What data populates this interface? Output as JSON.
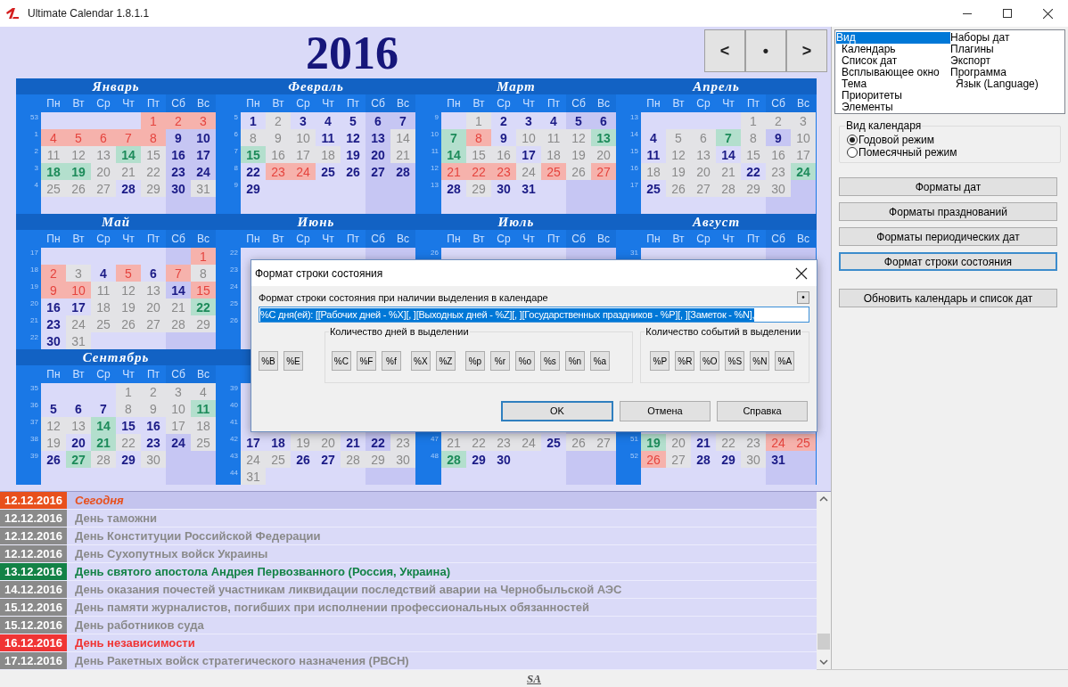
{
  "window": {
    "title": "Ultimate Calendar 1.8.1.1"
  },
  "header": {
    "year": "2016",
    "nav": [
      "<",
      "•",
      ">"
    ]
  },
  "months": [
    {
      "name": "Январь",
      "weekdays": [
        "Пн",
        "Вт",
        "Ср",
        "Чт",
        "Пт",
        "Сб",
        "Вс"
      ],
      "weeks": [
        {
          "week": "53",
          "days": [
            {
              "day": "1",
              "kind": "holiday"
            },
            {
              "day": "2",
              "kind": "holiday"
            },
            {
              "day": "3",
              "kind": "holiday"
            }
          ]
        },
        {
          "week": "1",
          "days": [
            {
              "day": "4",
              "kind": "holiday"
            },
            {
              "day": "5",
              "kind": "holiday"
            },
            {
              "day": "6",
              "kind": "holiday"
            },
            {
              "day": "7",
              "kind": "holiday"
            },
            {
              "day": "8",
              "kind": "holiday"
            },
            {
              "day": "9",
              "kind": "work"
            },
            {
              "day": "10",
              "kind": "work"
            }
          ]
        },
        {
          "week": "2",
          "days": [
            {
              "day": "11",
              "kind": "event"
            },
            {
              "day": "12",
              "kind": "event"
            },
            {
              "day": "13",
              "kind": "event"
            },
            {
              "day": "14",
              "kind": "green"
            },
            {
              "day": "15",
              "kind": "event"
            },
            {
              "day": "16",
              "kind": "work"
            },
            {
              "day": "17",
              "kind": "work"
            }
          ]
        },
        {
          "week": "3",
          "days": [
            {
              "day": "18",
              "kind": "green"
            },
            {
              "day": "19",
              "kind": "green"
            },
            {
              "day": "20",
              "kind": "event"
            },
            {
              "day": "21",
              "kind": "event"
            },
            {
              "day": "22",
              "kind": "event"
            },
            {
              "day": "23",
              "kind": "work"
            },
            {
              "day": "24",
              "kind": "work"
            }
          ]
        },
        {
          "week": "4",
          "days": [
            {
              "day": "25",
              "kind": "event"
            },
            {
              "day": "26",
              "kind": "event"
            },
            {
              "day": "27",
              "kind": "event"
            },
            {
              "day": "28",
              "kind": "work"
            },
            {
              "day": "29",
              "kind": "event"
            },
            {
              "day": "30",
              "kind": "work"
            },
            {
              "day": "31",
              "kind": "event"
            }
          ]
        }
      ]
    },
    {
      "name": "Февраль",
      "weekdays": [
        "Пн",
        "Вт",
        "Ср",
        "Чт",
        "Пт",
        "Сб",
        "Вс"
      ],
      "weeks": [
        {
          "week": "5",
          "days": [
            {
              "day": "1",
              "kind": "work"
            },
            {
              "day": "2",
              "kind": "event"
            },
            {
              "day": "3",
              "kind": "work"
            },
            {
              "day": "4",
              "kind": "work"
            },
            {
              "day": "5",
              "kind": "work"
            },
            {
              "day": "6",
              "kind": "work"
            },
            {
              "day": "7",
              "kind": "work"
            }
          ]
        },
        {
          "week": "6",
          "days": [
            {
              "day": "8",
              "kind": "event"
            },
            {
              "day": "9",
              "kind": "event"
            },
            {
              "day": "10",
              "kind": "event"
            },
            {
              "day": "11",
              "kind": "work"
            },
            {
              "day": "12",
              "kind": "work"
            },
            {
              "day": "13",
              "kind": "work"
            },
            {
              "day": "14",
              "kind": "event"
            }
          ]
        },
        {
          "week": "7",
          "days": [
            {
              "day": "15",
              "kind": "green"
            },
            {
              "day": "16",
              "kind": "event"
            },
            {
              "day": "17",
              "kind": "event"
            },
            {
              "day": "18",
              "kind": "event"
            },
            {
              "day": "19",
              "kind": "work"
            },
            {
              "day": "20",
              "kind": "work"
            },
            {
              "day": "21",
              "kind": "event"
            }
          ]
        },
        {
          "week": "8",
          "days": [
            {
              "day": "22",
              "kind": "work"
            },
            {
              "day": "23",
              "kind": "holiday"
            },
            {
              "day": "24",
              "kind": "holiday"
            },
            {
              "day": "25",
              "kind": "work"
            },
            {
              "day": "26",
              "kind": "work"
            },
            {
              "day": "27",
              "kind": "work"
            },
            {
              "day": "28",
              "kind": "work"
            }
          ]
        },
        {
          "week": "9",
          "days": [
            {
              "day": "29",
              "kind": "work"
            }
          ]
        }
      ]
    },
    {
      "name": "Март",
      "weekdays": [
        "Пн",
        "Вт",
        "Ср",
        "Чт",
        "Пт",
        "Сб",
        "Вс"
      ],
      "weeks": [
        {
          "week": "9",
          "days": [
            {
              "day": "1",
              "kind": "event"
            },
            {
              "day": "2",
              "kind": "work"
            },
            {
              "day": "3",
              "kind": "work"
            },
            {
              "day": "4",
              "kind": "work"
            },
            {
              "day": "5",
              "kind": "work"
            },
            {
              "day": "6",
              "kind": "work"
            }
          ]
        },
        {
          "week": "10",
          "days": [
            {
              "day": "7",
              "kind": "green"
            },
            {
              "day": "8",
              "kind": "holiday"
            },
            {
              "day": "9",
              "kind": "work"
            },
            {
              "day": "10",
              "kind": "event"
            },
            {
              "day": "11",
              "kind": "event"
            },
            {
              "day": "12",
              "kind": "event"
            },
            {
              "day": "13",
              "kind": "green"
            }
          ]
        },
        {
          "week": "11",
          "days": [
            {
              "day": "14",
              "kind": "green"
            },
            {
              "day": "15",
              "kind": "event"
            },
            {
              "day": "16",
              "kind": "event"
            },
            {
              "day": "17",
              "kind": "work"
            },
            {
              "day": "18",
              "kind": "event"
            },
            {
              "day": "19",
              "kind": "event"
            },
            {
              "day": "20",
              "kind": "event"
            }
          ]
        },
        {
          "week": "12",
          "days": [
            {
              "day": "21",
              "kind": "holiday"
            },
            {
              "day": "22",
              "kind": "holiday"
            },
            {
              "day": "23",
              "kind": "holiday"
            },
            {
              "day": "24",
              "kind": "event"
            },
            {
              "day": "25",
              "kind": "holiday"
            },
            {
              "day": "26",
              "kind": "event"
            },
            {
              "day": "27",
              "kind": "holiday"
            }
          ]
        },
        {
          "week": "13",
          "days": [
            {
              "day": "28",
              "kind": "work"
            },
            {
              "day": "29",
              "kind": "event"
            },
            {
              "day": "30",
              "kind": "work"
            },
            {
              "day": "31",
              "kind": "work"
            }
          ]
        }
      ]
    },
    {
      "name": "Апрель",
      "weekdays": [
        "Пн",
        "Вт",
        "Ср",
        "Чт",
        "Пт",
        "Сб",
        "Вс"
      ],
      "weeks": [
        {
          "week": "13",
          "days": [
            {
              "day": "1",
              "kind": "event"
            },
            {
              "day": "2",
              "kind": "event"
            },
            {
              "day": "3",
              "kind": "event"
            }
          ]
        },
        {
          "week": "14",
          "days": [
            {
              "day": "4",
              "kind": "work"
            },
            {
              "day": "5",
              "kind": "event"
            },
            {
              "day": "6",
              "kind": "event"
            },
            {
              "day": "7",
              "kind": "green"
            },
            {
              "day": "8",
              "kind": "event"
            },
            {
              "day": "9",
              "kind": "work"
            },
            {
              "day": "10",
              "kind": "event"
            }
          ]
        },
        {
          "week": "15",
          "days": [
            {
              "day": "11",
              "kind": "work"
            },
            {
              "day": "12",
              "kind": "event"
            },
            {
              "day": "13",
              "kind": "event"
            },
            {
              "day": "14",
              "kind": "work"
            },
            {
              "day": "15",
              "kind": "event"
            },
            {
              "day": "16",
              "kind": "event"
            },
            {
              "day": "17",
              "kind": "event"
            }
          ]
        },
        {
          "week": "16",
          "days": [
            {
              "day": "18",
              "kind": "event"
            },
            {
              "day": "19",
              "kind": "event"
            },
            {
              "day": "20",
              "kind": "event"
            },
            {
              "day": "21",
              "kind": "event"
            },
            {
              "day": "22",
              "kind": "work"
            },
            {
              "day": "23",
              "kind": "event"
            },
            {
              "day": "24",
              "kind": "green"
            }
          ]
        },
        {
          "week": "17",
          "days": [
            {
              "day": "25",
              "kind": "work"
            },
            {
              "day": "26",
              "kind": "event"
            },
            {
              "day": "27",
              "kind": "event"
            },
            {
              "day": "28",
              "kind": "event"
            },
            {
              "day": "29",
              "kind": "event"
            },
            {
              "day": "30",
              "kind": "event"
            }
          ]
        }
      ]
    },
    {
      "name": "Май",
      "weekdays": [
        "Пн",
        "Вт",
        "Ср",
        "Чт",
        "Пт",
        "Сб",
        "Вс"
      ],
      "weeks": [
        {
          "week": "17",
          "days": [
            {
              "day": "1",
              "kind": "holiday"
            }
          ]
        },
        {
          "week": "18",
          "days": [
            {
              "day": "2",
              "kind": "holiday"
            },
            {
              "day": "3",
              "kind": "event"
            },
            {
              "day": "4",
              "kind": "work"
            },
            {
              "day": "5",
              "kind": "holiday"
            },
            {
              "day": "6",
              "kind": "work"
            },
            {
              "day": "7",
              "kind": "holiday"
            },
            {
              "day": "8",
              "kind": "event"
            }
          ]
        },
        {
          "week": "19",
          "days": [
            {
              "day": "9",
              "kind": "holiday"
            },
            {
              "day": "10",
              "kind": "holiday"
            },
            {
              "day": "11",
              "kind": "event"
            },
            {
              "day": "12",
              "kind": "event"
            },
            {
              "day": "13",
              "kind": "event"
            },
            {
              "day": "14",
              "kind": "work"
            },
            {
              "day": "15",
              "kind": "holiday"
            }
          ]
        },
        {
          "week": "20",
          "days": [
            {
              "day": "16",
              "kind": "work"
            },
            {
              "day": "17",
              "kind": "work"
            },
            {
              "day": "18",
              "kind": "event"
            },
            {
              "day": "19",
              "kind": "event"
            },
            {
              "day": "20",
              "kind": "event"
            },
            {
              "day": "21",
              "kind": "event"
            },
            {
              "day": "22",
              "kind": "green"
            }
          ]
        },
        {
          "week": "21",
          "days": [
            {
              "day": "23",
              "kind": "work"
            },
            {
              "day": "24",
              "kind": "event"
            },
            {
              "day": "25",
              "kind": "event"
            },
            {
              "day": "26",
              "kind": "event"
            },
            {
              "day": "27",
              "kind": "event"
            },
            {
              "day": "28",
              "kind": "event"
            },
            {
              "day": "29",
              "kind": "event"
            }
          ]
        },
        {
          "week": "22",
          "days": [
            {
              "day": "30",
              "kind": "work"
            },
            {
              "day": "31",
              "kind": "event"
            }
          ]
        }
      ]
    },
    {
      "name": "Июнь",
      "weekdays": [
        "Пн",
        "Вт",
        "Ср",
        "Чт",
        "Пт",
        "Сб",
        "Вс"
      ],
      "weeks": [
        {
          "week": "22"
        },
        {
          "week": "23"
        },
        {
          "week": "24"
        },
        {
          "week": "25"
        },
        {
          "week": "26"
        }
      ]
    },
    {
      "name": "Июль",
      "weekdays": [
        "Пн",
        "Вт",
        "Ср",
        "Чт",
        "Пт",
        "Сб",
        "Вс"
      ],
      "weeks": [
        {
          "week": "26"
        }
      ]
    },
    {
      "name": "Август",
      "weekdays": [
        "Пн",
        "Вт",
        "Ср",
        "Чт",
        "Пт",
        "Сб",
        "Вс"
      ],
      "weeks": [
        {
          "week": "31"
        }
      ]
    },
    {
      "name": "Сентябрь",
      "weekdays": [
        "Пн",
        "Вт",
        "Ср",
        "Чт",
        "Пт",
        "Сб",
        "Вс"
      ],
      "weeks": [
        {
          "week": "35",
          "days": [
            {
              "day": "1",
              "kind": "event"
            },
            {
              "day": "2",
              "kind": "event"
            },
            {
              "day": "3",
              "kind": "event"
            },
            {
              "day": "4",
              "kind": "event"
            }
          ]
        },
        {
          "week": "36",
          "days": [
            {
              "day": "5",
              "kind": "work"
            },
            {
              "day": "6",
              "kind": "work"
            },
            {
              "day": "7",
              "kind": "work"
            },
            {
              "day": "8",
              "kind": "event"
            },
            {
              "day": "9",
              "kind": "event"
            },
            {
              "day": "10",
              "kind": "event"
            },
            {
              "day": "11",
              "kind": "green"
            }
          ]
        },
        {
          "week": "37",
          "days": [
            {
              "day": "12",
              "kind": "event"
            },
            {
              "day": "13",
              "kind": "event"
            },
            {
              "day": "14",
              "kind": "green"
            },
            {
              "day": "15",
              "kind": "work"
            },
            {
              "day": "16",
              "kind": "work"
            },
            {
              "day": "17",
              "kind": "event"
            },
            {
              "day": "18",
              "kind": "event"
            }
          ]
        },
        {
          "week": "38",
          "days": [
            {
              "day": "19",
              "kind": "event"
            },
            {
              "day": "20",
              "kind": "work"
            },
            {
              "day": "21",
              "kind": "green"
            },
            {
              "day": "22",
              "kind": "event"
            },
            {
              "day": "23",
              "kind": "work"
            },
            {
              "day": "24",
              "kind": "work"
            },
            {
              "day": "25",
              "kind": "event"
            }
          ]
        },
        {
          "week": "39",
          "days": [
            {
              "day": "26",
              "kind": "work"
            },
            {
              "day": "27",
              "kind": "green"
            },
            {
              "day": "28",
              "kind": "event"
            },
            {
              "day": "29",
              "kind": "work"
            },
            {
              "day": "30",
              "kind": "event"
            }
          ]
        }
      ]
    },
    {
      "weeks": [
        {
          "week": "39"
        },
        {
          "week": "40"
        },
        {
          "week": "41"
        },
        {
          "week": "42",
          "days": [
            {
              "day": "17",
              "kind": "work"
            },
            {
              "day": "18",
              "kind": "work"
            },
            {
              "day": "19",
              "kind": "event"
            },
            {
              "day": "20",
              "kind": "event"
            },
            {
              "day": "21",
              "kind": "work"
            },
            {
              "day": "22",
              "kind": "work"
            },
            {
              "day": "23",
              "kind": "event"
            }
          ]
        },
        {
          "week": "43",
          "days": [
            {
              "day": "24",
              "kind": "event"
            },
            {
              "day": "25",
              "kind": "event"
            },
            {
              "day": "26",
              "kind": "work"
            },
            {
              "day": "27",
              "kind": "work"
            },
            {
              "day": "28",
              "kind": "event"
            },
            {
              "day": "29",
              "kind": "event"
            },
            {
              "day": "30",
              "kind": "event"
            }
          ]
        },
        {
          "week": "44",
          "days": [
            {
              "day": "31",
              "kind": "event"
            }
          ]
        }
      ]
    },
    {
      "weeks": [
        {
          "week": "47",
          "days": [
            {
              "day": "21",
              "kind": "event"
            },
            {
              "day": "22",
              "kind": "event"
            },
            {
              "day": "23",
              "kind": "event"
            },
            {
              "day": "24",
              "kind": "event"
            },
            {
              "day": "25",
              "kind": "work"
            },
            {
              "day": "26",
              "kind": "event"
            },
            {
              "day": "27",
              "kind": "event"
            }
          ]
        },
        {
          "week": "48",
          "days": [
            {
              "day": "28",
              "kind": "green"
            },
            {
              "day": "29",
              "kind": "work"
            },
            {
              "day": "30",
              "kind": "work"
            }
          ]
        }
      ]
    },
    {
      "weeks": [
        {
          "week": "51",
          "days": [
            {
              "day": "19",
              "kind": "green"
            },
            {
              "day": "20",
              "kind": "event"
            },
            {
              "day": "21",
              "kind": "work"
            },
            {
              "day": "22",
              "kind": "event"
            },
            {
              "day": "23",
              "kind": "event"
            },
            {
              "day": "24",
              "kind": "holiday"
            },
            {
              "day": "25",
              "kind": "holiday"
            }
          ]
        },
        {
          "week": "52",
          "days": [
            {
              "day": "26",
              "kind": "holiday"
            },
            {
              "day": "27",
              "kind": "event"
            },
            {
              "day": "28",
              "kind": "work"
            },
            {
              "day": "29",
              "kind": "work"
            },
            {
              "day": "30",
              "kind": "event"
            },
            {
              "day": "31",
              "kind": "work"
            }
          ]
        }
      ]
    }
  ],
  "events": [
    {
      "date": "12.12.2016",
      "title": "Сегодня",
      "kind": "today",
      "selected": true
    },
    {
      "date": "12.12.2016",
      "title": "День таможни",
      "kind": "regular",
      "selected": false
    },
    {
      "date": "12.12.2016",
      "title": "День Конституции Российской Федерации",
      "kind": "regular",
      "selected": false
    },
    {
      "date": "12.12.2016",
      "title": "День Сухопутных войск Украины",
      "kind": "regular",
      "selected": false
    },
    {
      "date": "13.12.2016",
      "title": "День святого апостола Андрея Первозванного (Россия, Украина)",
      "kind": "religious",
      "selected": false
    },
    {
      "date": "14.12.2016",
      "title": "День оказания почестей участникам ликвидации последствий аварии на Чернобыльской АЭС",
      "kind": "regular",
      "selected": false
    },
    {
      "date": "15.12.2016",
      "title": "День памяти журналистов, погибших при исполнении профессиональных обязанностей",
      "kind": "regular",
      "selected": false
    },
    {
      "date": "15.12.2016",
      "title": "День работников суда",
      "kind": "regular",
      "selected": false
    },
    {
      "date": "16.12.2016",
      "title": "День независимости",
      "kind": "holiday",
      "selected": false
    },
    {
      "date": "17.12.2016",
      "title": "День Ракетных войск стратегического назначения (РВСН)",
      "kind": "regular",
      "selected": false
    }
  ],
  "status_bar": {
    "logo": "SA"
  },
  "settings_tree": {
    "columns": [
      {
        "items": [
          {
            "label": "Вид",
            "selected": true,
            "children": [
              {
                "label": "Календарь",
                "selected": false
              },
              {
                "label": "Список дат",
                "selected": false
              },
              {
                "label": "Всплывающее окно",
                "selected": false
              },
              {
                "label": "Тема",
                "selected": false
              },
              {
                "label": "Приоритеты",
                "selected": false
              },
              {
                "label": "Элементы",
                "selected": false
              }
            ]
          }
        ]
      },
      {
        "items": [
          {
            "label": "Наборы дат",
            "selected": false
          },
          {
            "label": "Плагины",
            "selected": false
          },
          {
            "label": "Экспорт",
            "selected": false
          },
          {
            "label": "Программа",
            "selected": false,
            "children": [
              {
                "label": "Язык (Language)",
                "selected": false
              }
            ]
          }
        ]
      }
    ]
  },
  "calendar_view": {
    "title": "Вид календаря",
    "options": [
      {
        "label": "Годовой режим",
        "selected": true
      },
      {
        "label": "Помесячный режим",
        "selected": false
      }
    ]
  },
  "format_buttons": [
    {
      "label": "Форматы дат",
      "focused": false
    },
    {
      "label": "Форматы празднований",
      "focused": false
    },
    {
      "label": "Форматы периодических дат",
      "focused": false
    },
    {
      "label": "Формат строки состояния",
      "focused": true
    }
  ],
  "refresh_button": {
    "label": "Обновить календарь и список дат",
    "focused": false
  },
  "dialog": {
    "title": "Формат строки состояния",
    "label": "Формат строки состояния при наличии выделения в календаре",
    "dot_button": "•",
    "format": {
      "value": "%C дня(ей): [[Рабочих дней - %X][, ][Выходных дней - %Z][, ][Государственных праздников - %P][, ][Заметок - %N],",
      "selected": true
    },
    "extra_buttons": [
      "%B",
      "%E"
    ],
    "day_group": {
      "title": "Количество дней в выделении",
      "button_groups": [
        [
          "%C",
          "%F",
          "%f"
        ],
        [
          "%X",
          "%Z"
        ],
        [
          "%p",
          "%r",
          "%o",
          "%s",
          "%n",
          "%a"
        ]
      ]
    },
    "event_group": {
      "title": "Количество событий в выделении",
      "buttons": [
        "%P",
        "%R",
        "%O",
        "%S",
        "%N",
        "%A"
      ]
    },
    "actions": [
      {
        "label": "OK",
        "default": true
      },
      {
        "label": "Отмена",
        "default": false
      },
      {
        "label": "Справка",
        "default": false
      }
    ]
  }
}
